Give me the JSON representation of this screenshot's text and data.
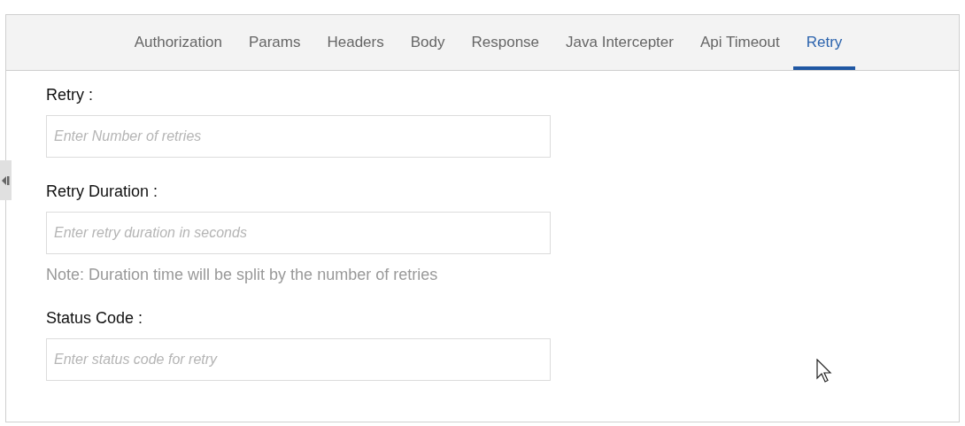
{
  "tabs": [
    {
      "label": "Authorization",
      "selected": false
    },
    {
      "label": "Params",
      "selected": false
    },
    {
      "label": "Headers",
      "selected": false
    },
    {
      "label": "Body",
      "selected": false
    },
    {
      "label": "Response",
      "selected": false
    },
    {
      "label": "Java Intercepter",
      "selected": false
    },
    {
      "label": "Api Timeout",
      "selected": false
    },
    {
      "label": "Retry",
      "selected": true
    }
  ],
  "fields": [
    {
      "label": "Retry :",
      "placeholder": "Enter Number of retries"
    },
    {
      "label": "Retry Duration :",
      "placeholder": "Enter retry duration in seconds",
      "note": "Note: Duration time will be split by the number of retries"
    },
    {
      "label": "Status Code :",
      "placeholder": "Enter status code for retry"
    }
  ]
}
